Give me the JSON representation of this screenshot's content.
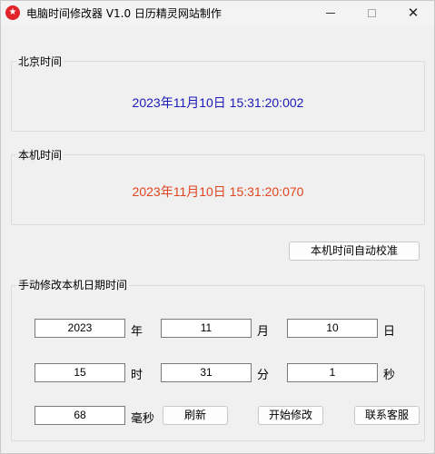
{
  "window": {
    "title": "电脑时间修改器 V1.0 日历精灵网站制作",
    "icon": "star-icon",
    "min_icon": "minimize-icon",
    "max_icon": "maximize-icon",
    "close_glyph": "✕"
  },
  "beijing": {
    "label": "北京时间",
    "value": "2023年11月10日  15:31:20:002",
    "color": "#1a1ab8"
  },
  "local": {
    "label": "本机时间",
    "value": "2023年11月10日  15:31:20:070",
    "color": "#e0451f"
  },
  "auto_sync_button": "本机时间自动校准",
  "manual": {
    "label": "手动修改本机日期时间",
    "year": "2023",
    "year_unit": "年",
    "month": "11",
    "month_unit": "月",
    "day": "10",
    "day_unit": "日",
    "hour": "15",
    "hour_unit": "时",
    "minute": "31",
    "minute_unit": "分",
    "second": "1",
    "second_unit": "秒",
    "ms": "68",
    "ms_unit": "毫秒",
    "refresh_button": "刷新",
    "apply_button": "开始修改",
    "contact_button": "联系客服"
  }
}
